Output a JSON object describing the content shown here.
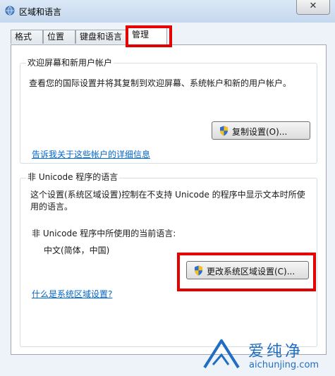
{
  "window": {
    "title": "区域和语言",
    "close_glyph": "✕"
  },
  "tabs": [
    {
      "label": "格式"
    },
    {
      "label": "位置"
    },
    {
      "label": "键盘和语言"
    },
    {
      "label": "管理",
      "active": true
    }
  ],
  "welcome_group": {
    "title": "欢迎屏幕和新用户帐户",
    "description": "查看您的国际设置并将其复制到欢迎屏幕、系统帐户和新的用户帐户。",
    "copy_button": "复制设置(O)...",
    "info_link": "告诉我关于这些帐户的详细信息"
  },
  "unicode_group": {
    "title": "非 Unicode 程序的语言",
    "description_line1": "这个设置(系统区域设置)控制在不支持 Unicode 的程序中显示文本时所使",
    "description_line2": "用的语言。",
    "current_label": "非 Unicode 程序中所使用的当前语言:",
    "current_value": "中文(简体，中国)",
    "change_button": "更改系统区域设置(C)...",
    "help_link": "什么是系统区域设置?"
  },
  "watermark": {
    "brand": "爱纯净",
    "url": "aichunjing.com"
  },
  "colors": {
    "highlight": "#e50000",
    "link": "#0066cc",
    "watermark": "#1f6ec1"
  },
  "icons": {
    "app": "globe-icon",
    "button": "uac-shield-icon"
  }
}
